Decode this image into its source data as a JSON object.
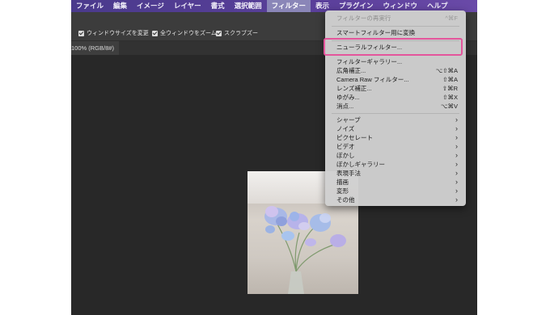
{
  "menubar": {
    "items": [
      "ファイル",
      "編集",
      "イメージ",
      "レイヤー",
      "書式",
      "選択範囲",
      "フィルター",
      "表示",
      "プラグイン",
      "ウィンドウ",
      "ヘルプ"
    ]
  },
  "options": {
    "resize_windows": "ウィンドウサイズを変更",
    "zoom_all": "全ウィンドウをズーム",
    "scrubby_zoom": "スクラブズー"
  },
  "document": {
    "tab_label": "100% (RGB/8#)"
  },
  "filter_menu": {
    "last_filter": {
      "label": "フィルターの再実行",
      "shortcut": "^⌘F"
    },
    "smart_filter": "スマートフィルター用に変換",
    "neural_filters": "ニューラルフィルター...",
    "group1": [
      {
        "label": "フィルターギャラリー...",
        "shortcut": ""
      },
      {
        "label": "広角補正...",
        "shortcut": "⌥⇧⌘A"
      },
      {
        "label": "Camera Raw フィルター...",
        "shortcut": "⇧⌘A"
      },
      {
        "label": "レンズ補正...",
        "shortcut": "⇧⌘R"
      },
      {
        "label": "ゆがみ...",
        "shortcut": "⇧⌘X"
      },
      {
        "label": "消点...",
        "shortcut": "⌥⌘V"
      }
    ],
    "submenus": [
      "シャープ",
      "ノイズ",
      "ピクセレート",
      "ビデオ",
      "ぼかし",
      "ぼかしギャラリー",
      "表現手法",
      "描画",
      "変形",
      "その他"
    ]
  },
  "colors": {
    "menubar": "#4a3a8c",
    "highlight": "#e4559c"
  }
}
